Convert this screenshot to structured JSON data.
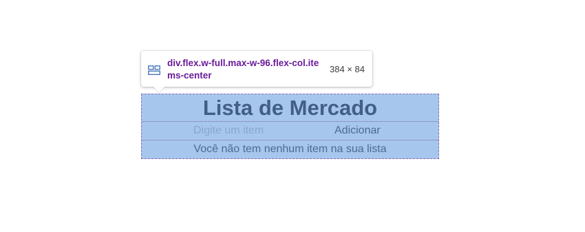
{
  "inspector_tooltip": {
    "icon": "flex-layout-icon",
    "selector": "div.flex.w-full.max-w-96.flex-col.items-center",
    "dimensions": "384 × 84",
    "selector_color": "#6a1b9a"
  },
  "app": {
    "title": "Lista de Mercado",
    "input": {
      "placeholder": "Digite um item",
      "value": ""
    },
    "add_button_label": "Adicionar",
    "empty_message": "Você não tem nenhum item na sua lista",
    "highlight_color": "#a7c6ee"
  }
}
